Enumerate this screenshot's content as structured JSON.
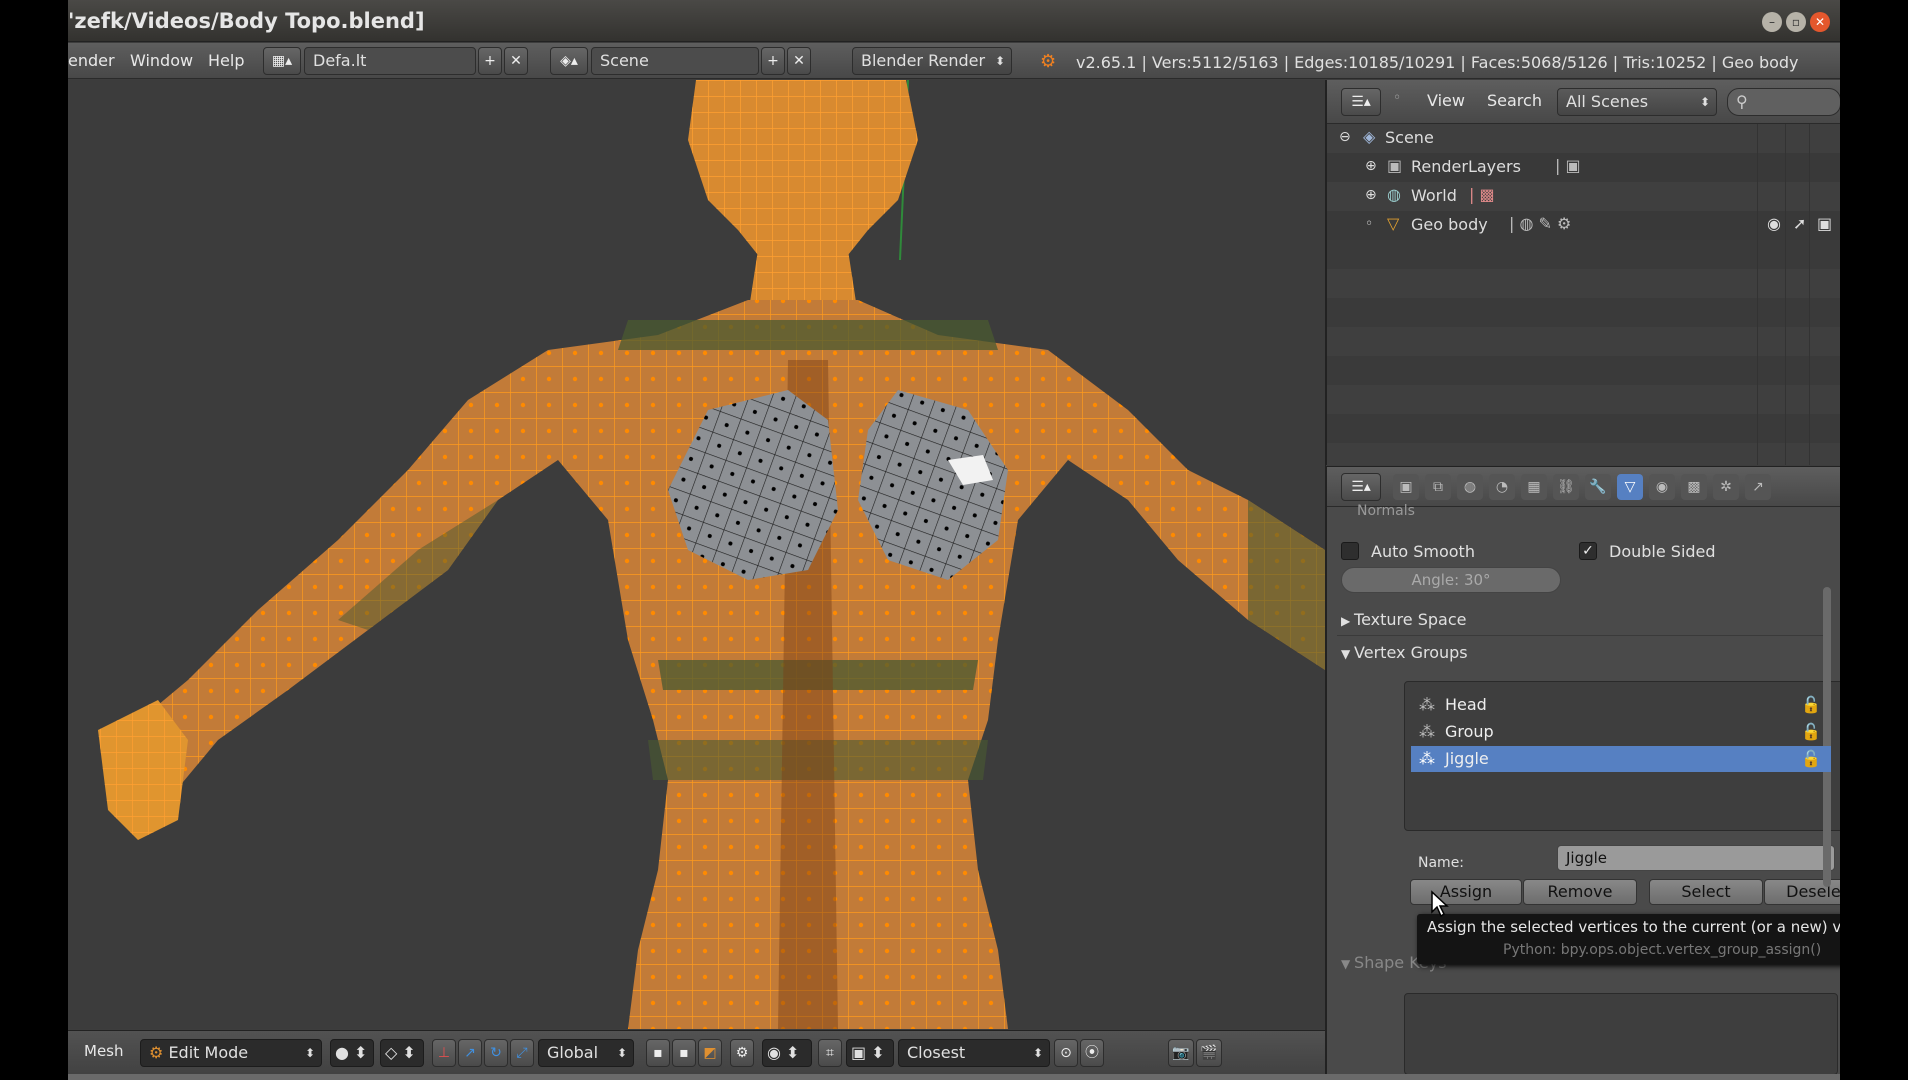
{
  "window": {
    "title": "'zefk/Videos/Body Topo.blend]"
  },
  "menubar": {
    "items": [
      "ender",
      "Window",
      "Help"
    ],
    "layout_field": "Defa.lt",
    "scene_field": "Scene",
    "engine_select": "Blender Render",
    "info_stats": "v2.65.1 | Vers:5112/5163 | Edges:10185/10291 | Faces:5068/5126 | Tris:10252 | Geo body"
  },
  "outliner": {
    "menu_view": "View",
    "menu_search": "Search",
    "scope_select": "All Scenes",
    "items": [
      {
        "label": "Scene",
        "icon": "scene-icon"
      },
      {
        "label": "RenderLayers",
        "icon": "renderlayers-icon"
      },
      {
        "label": "World",
        "icon": "world-icon"
      },
      {
        "label": "Geo body",
        "icon": "mesh-object-icon"
      }
    ]
  },
  "properties": {
    "normals_header": "Normals",
    "auto_smooth_label": "Auto Smooth",
    "double_sided_label": "Double Sided",
    "angle_field": "Angle: 30°",
    "texture_space_label": "Texture Space",
    "vertex_groups_label": "Vertex Groups",
    "groups": [
      {
        "name": "Head",
        "selected": false
      },
      {
        "name": "Group",
        "selected": false
      },
      {
        "name": "Jiggle",
        "selected": true
      }
    ],
    "name_label": "Name:",
    "name_value": "Jiggle",
    "buttons": {
      "assign": "Assign",
      "remove": "Remove",
      "select": "Select",
      "deselect": "Deselect"
    },
    "shape_keys_label": "Shape Keys"
  },
  "tooltip": {
    "text": "Assign the selected vertices to the current (or a new) vertex group",
    "python": "Python: bpy.ops.object.vertex_group_assign()"
  },
  "viewport_footer": {
    "mesh_menu": "Mesh",
    "mode_select": "Edit Mode",
    "orientation_select": "Global",
    "snap_select": "Closest"
  },
  "colors": {
    "wire": "#ff9a1c",
    "selected_row": "#5680c2",
    "viewport_bg": "#3c3c3c"
  }
}
